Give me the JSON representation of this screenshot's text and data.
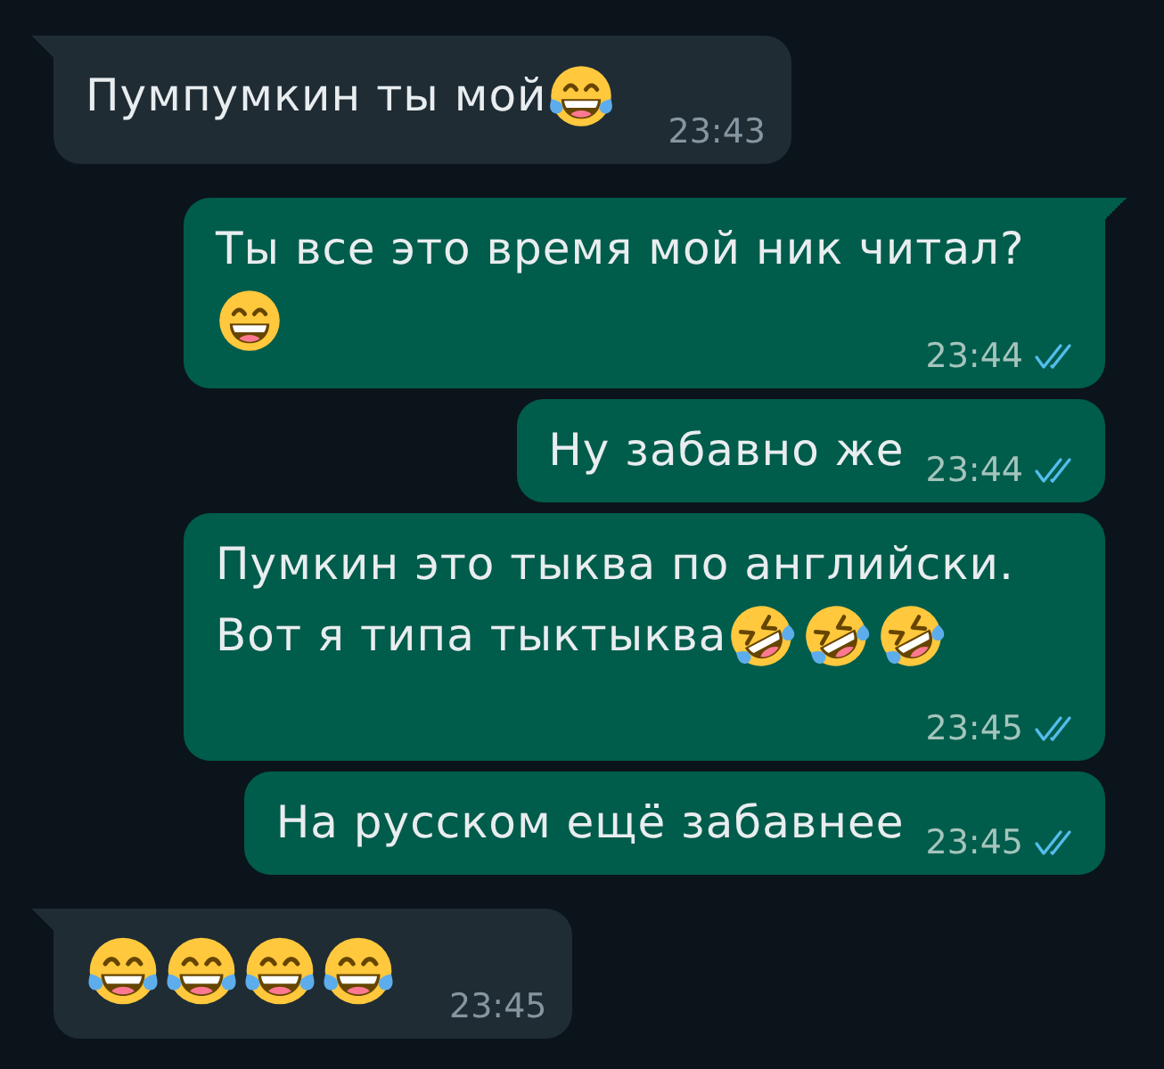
{
  "messages": [
    {
      "outgoing": false,
      "lines": [
        {
          "text": "Пумпумкин ты мой",
          "emoji": [
            {
              "kind": "tears_of_joy"
            }
          ]
        }
      ],
      "time": "23:43"
    },
    {
      "outgoing": true,
      "lines": [
        {
          "text": "Ты все это время мой ник читал?"
        },
        {
          "emoji": [
            {
              "kind": "grinning"
            }
          ]
        }
      ],
      "time": "23:44",
      "read": true
    },
    {
      "outgoing": true,
      "lines": [
        {
          "text": "Ну забавно же"
        }
      ],
      "time": "23:44",
      "read": true
    },
    {
      "outgoing": true,
      "lines": [
        {
          "text": "Пумкин это тыква по английски."
        },
        {
          "text": "Вот я типа тыктыква",
          "emoji": [
            {
              "kind": "rolling_laughing"
            },
            {
              "kind": "rolling_laughing"
            },
            {
              "kind": "rolling_laughing"
            }
          ]
        }
      ],
      "time": "23:45",
      "read": true
    },
    {
      "outgoing": true,
      "lines": [
        {
          "text": "На русском ещё забавнее"
        }
      ],
      "time": "23:45",
      "read": true
    },
    {
      "outgoing": false,
      "lines": [
        {
          "emoji": [
            {
              "kind": "tears_of_joy"
            },
            {
              "kind": "tears_of_joy"
            },
            {
              "kind": "tears_of_joy"
            },
            {
              "kind": "tears_of_joy"
            }
          ]
        }
      ],
      "time": "23:45"
    }
  ]
}
